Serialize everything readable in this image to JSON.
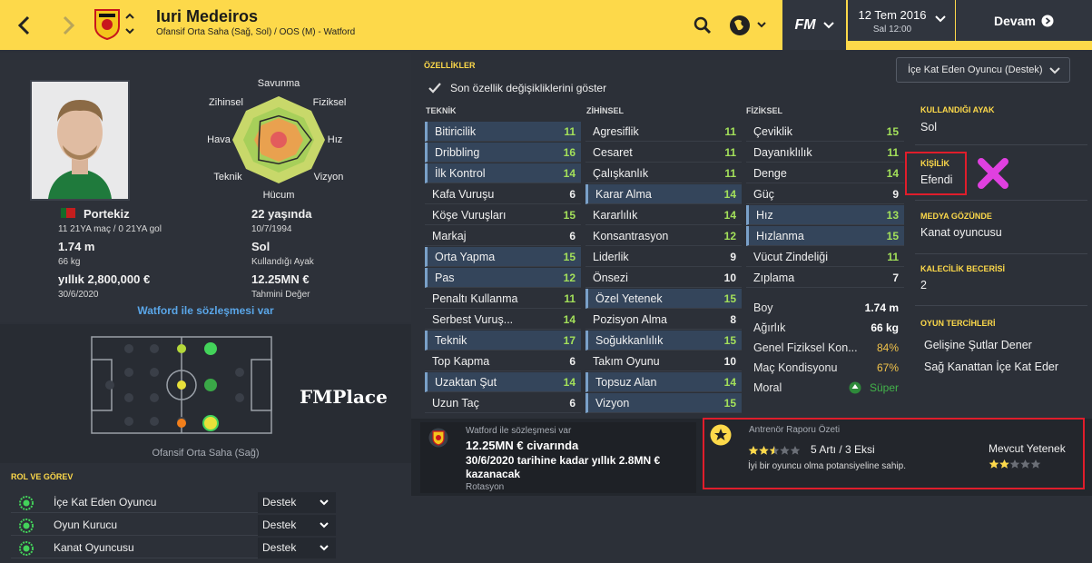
{
  "header": {
    "player_name": "Iuri Medeiros",
    "player_sub": "Ofansif Orta Saha (Sağ, Sol) / OOS (M) - Watford",
    "fm_label": "FM",
    "date_main": "12 Tem 2016",
    "date_sub": "Sal 12:00",
    "continue_label": "Devam",
    "icons": [
      "back-arrow-icon",
      "forward-arrow-icon",
      "club-crest-icon",
      "search-icon",
      "globe-icon",
      "chevron-down-icon",
      "play-icon"
    ],
    "colors": {
      "bar": "#fdd94a",
      "dark": "#30353e"
    }
  },
  "profile": {
    "nation": "Portekiz",
    "caps": "11 21YA maç / 0 21YA gol",
    "height": "1.74 m",
    "weight": "66 kg",
    "wage": "yıllık 2,800,000 €",
    "contract_end": "30/6/2020",
    "age": "22 yaşında",
    "dob": "10/7/1994",
    "foot": "Sol",
    "foot_label": "Kullandığı Ayak",
    "value": "12.25MN €",
    "value_label": "Tahmini Değer",
    "contract_link": "Watford ile sözleşmesi var"
  },
  "radar": {
    "labels": [
      "Savunma",
      "Fiziksel",
      "Hız",
      "Vizyon",
      "Hücum",
      "Teknik",
      "Hava",
      "Zihinsel"
    ],
    "values": [
      0.55,
      0.6,
      0.75,
      0.6,
      0.55,
      0.65,
      0.45,
      0.6
    ]
  },
  "pitch": {
    "position_label": "Ofansif Orta Saha (Sağ)",
    "watermark": "FMPlace"
  },
  "roles": {
    "title": "ROL VE GÖREV",
    "items": [
      {
        "name": "İçe Kat Eden Oyuncu",
        "duty": "Destek"
      },
      {
        "name": "Oyun Kurucu",
        "duty": "Destek"
      },
      {
        "name": "Kanat Oyuncusu",
        "duty": "Destek"
      }
    ]
  },
  "attributes": {
    "title": "ÖZELLİKLER",
    "role_select": "İçe Kat Eden Oyuncu (Destek)",
    "show_changes": "Son özellik değişikliklerini göster",
    "technical_head": "TEKNİK",
    "mental_head": "ZİHİNSEL",
    "physical_head": "FİZİKSEL",
    "technical": [
      {
        "name": "Bitiricilik",
        "value": "11",
        "hl": true
      },
      {
        "name": "Dribbling",
        "value": "16",
        "hl": true
      },
      {
        "name": "İlk Kontrol",
        "value": "14",
        "hl": true
      },
      {
        "name": "Kafa Vuruşu",
        "value": "6",
        "hl": false
      },
      {
        "name": "Köşe Vuruşları",
        "value": "15",
        "hl": false
      },
      {
        "name": "Markaj",
        "value": "6",
        "hl": false
      },
      {
        "name": "Orta Yapma",
        "value": "15",
        "hl": true
      },
      {
        "name": "Pas",
        "value": "12",
        "hl": true
      },
      {
        "name": "Penaltı Kullanma",
        "value": "11",
        "hl": false
      },
      {
        "name": "Serbest Vuruş...",
        "value": "14",
        "hl": false
      },
      {
        "name": "Teknik",
        "value": "17",
        "hl": true
      },
      {
        "name": "Top Kapma",
        "value": "6",
        "hl": false
      },
      {
        "name": "Uzaktan Şut",
        "value": "14",
        "hl": true
      },
      {
        "name": "Uzun Taç",
        "value": "6",
        "hl": false
      }
    ],
    "mental": [
      {
        "name": "Agresiflik",
        "value": "11",
        "hl": false
      },
      {
        "name": "Cesaret",
        "value": "11",
        "hl": false
      },
      {
        "name": "Çalışkanlık",
        "value": "11",
        "hl": false
      },
      {
        "name": "Karar Alma",
        "value": "14",
        "hl": true
      },
      {
        "name": "Kararlılık",
        "value": "14",
        "hl": false
      },
      {
        "name": "Konsantrasyon",
        "value": "12",
        "hl": false
      },
      {
        "name": "Liderlik",
        "value": "9",
        "hl": false
      },
      {
        "name": "Önsezi",
        "value": "10",
        "hl": false
      },
      {
        "name": "Özel Yetenek",
        "value": "15",
        "hl": true
      },
      {
        "name": "Pozisyon Alma",
        "value": "8",
        "hl": false
      },
      {
        "name": "Soğukkanlılık",
        "value": "15",
        "hl": true
      },
      {
        "name": "Takım Oyunu",
        "value": "10",
        "hl": false
      },
      {
        "name": "Topsuz Alan",
        "value": "14",
        "hl": true
      },
      {
        "name": "Vizyon",
        "value": "15",
        "hl": true
      }
    ],
    "physical": [
      {
        "name": "Çeviklik",
        "value": "15",
        "hl": false
      },
      {
        "name": "Dayanıklılık",
        "value": "11",
        "hl": false
      },
      {
        "name": "Denge",
        "value": "14",
        "hl": false
      },
      {
        "name": "Güç",
        "value": "9",
        "hl": false
      },
      {
        "name": "Hız",
        "value": "13",
        "hl": true
      },
      {
        "name": "Hızlanma",
        "value": "15",
        "hl": true
      },
      {
        "name": "Vücut Zindeliği",
        "value": "11",
        "hl": false
      },
      {
        "name": "Zıplama",
        "value": "7",
        "hl": false
      }
    ],
    "physical_extra": [
      {
        "name": "Boy",
        "value": "1.74 m"
      },
      {
        "name": "Ağırlık",
        "value": "66 kg"
      },
      {
        "name": "Genel Fiziksel Kon...",
        "value": "84%"
      },
      {
        "name": "Maç Kondisyonu",
        "value": "67%"
      },
      {
        "name": "Moral",
        "value": "Süper"
      }
    ]
  },
  "details": {
    "foot_title": "KULLANDIĞI AYAK",
    "foot_value": "Sol",
    "personality_title": "KİŞİLİK",
    "personality_value": "Efendi",
    "media_title": "MEDYA GÖZÜNDE",
    "media_value": "Kanat oyuncusu",
    "gk_title": "KALECİLİK BECERİSİ",
    "gk_value": "2",
    "prefs_title": "OYUN TERCİHLERİ",
    "prefs": [
      "Gelişine Şutlar Dener",
      "Sağ Kanattan İçe Kat Eder"
    ]
  },
  "contract_card": {
    "title": "Watford ile sözleşmesi var",
    "value": "12.25MN € civarında",
    "detail": "30/6/2020 tarihine kadar yıllık 2.8MN € kazanacak",
    "status": "Rotasyon"
  },
  "report": {
    "title": "Antrenör Raporu Özeti",
    "summary": "5 Artı / 3 Eksi",
    "note": "İyi bir oyuncu olma potansiyeline sahip.",
    "current_label": "Mevcut Yetenek",
    "potential_stars": 2.5,
    "current_stars": 2
  }
}
